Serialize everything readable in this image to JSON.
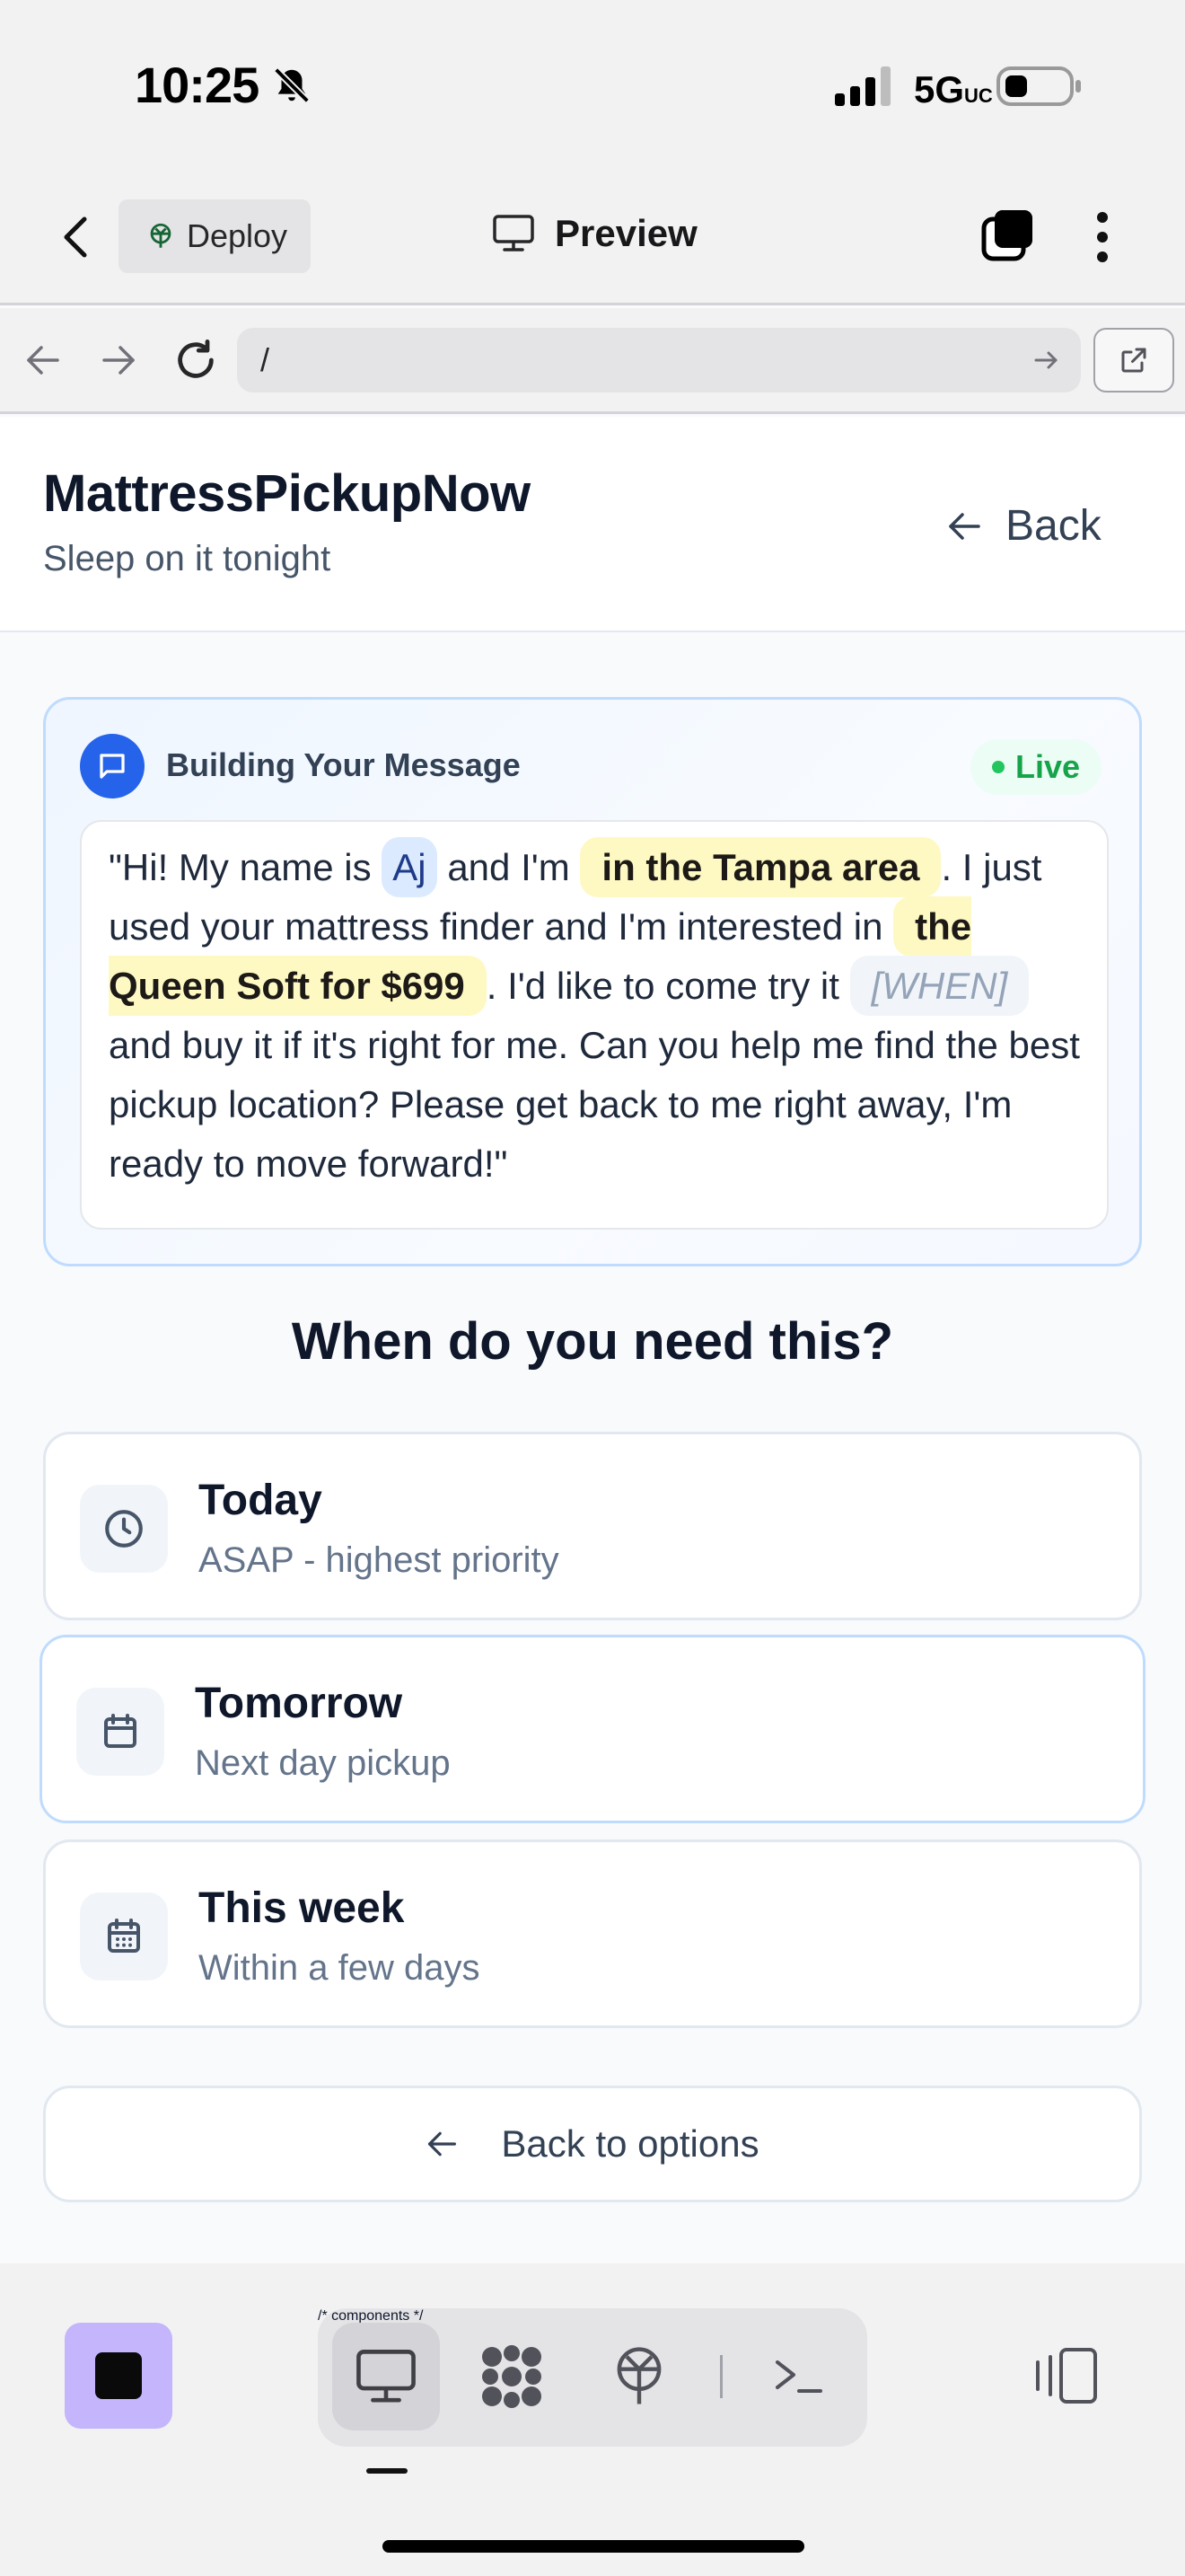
{
  "status_bar": {
    "time": "10:25",
    "network": "5G",
    "network_sub": "UC"
  },
  "toolbar": {
    "deploy_label": "Deploy",
    "preview_label": "Preview"
  },
  "url_bar": {
    "value": "/"
  },
  "site": {
    "brand": "MattressPickupNow",
    "tagline": "Sleep on it tonight",
    "back_label": "Back"
  },
  "message_card": {
    "title": "Building Your Message",
    "live_label": "Live",
    "parts": {
      "p1": "\"Hi! My name is ",
      "name": "Aj",
      "p2": " and I'm ",
      "location": "in the Tampa area",
      "p3": ". I just used your mattress finder and I'm interested in ",
      "product": "the Queen Soft for $699",
      "p4": ". I'd like to come try it ",
      "when": "[WHEN]",
      "p5": " and buy it if it's right for me. Can you help me find the best pickup location? Please get back to me right away, I'm ready to move forward!\""
    }
  },
  "question": "When do you need this?",
  "options": [
    {
      "title": "Today",
      "subtitle": "ASAP - highest priority",
      "icon": "clock-icon"
    },
    {
      "title": "Tomorrow",
      "subtitle": "Next day pickup",
      "icon": "calendar-icon"
    },
    {
      "title": "This week",
      "subtitle": "Within a few days",
      "icon": "calendar-days-icon"
    }
  ],
  "back_to_options_label": "Back to options",
  "colors": {
    "accent_blue": "#2563eb",
    "live_green": "#16a34a",
    "highlight_yellow": "#fef9c3",
    "stop_purple": "#c4b5fd"
  }
}
